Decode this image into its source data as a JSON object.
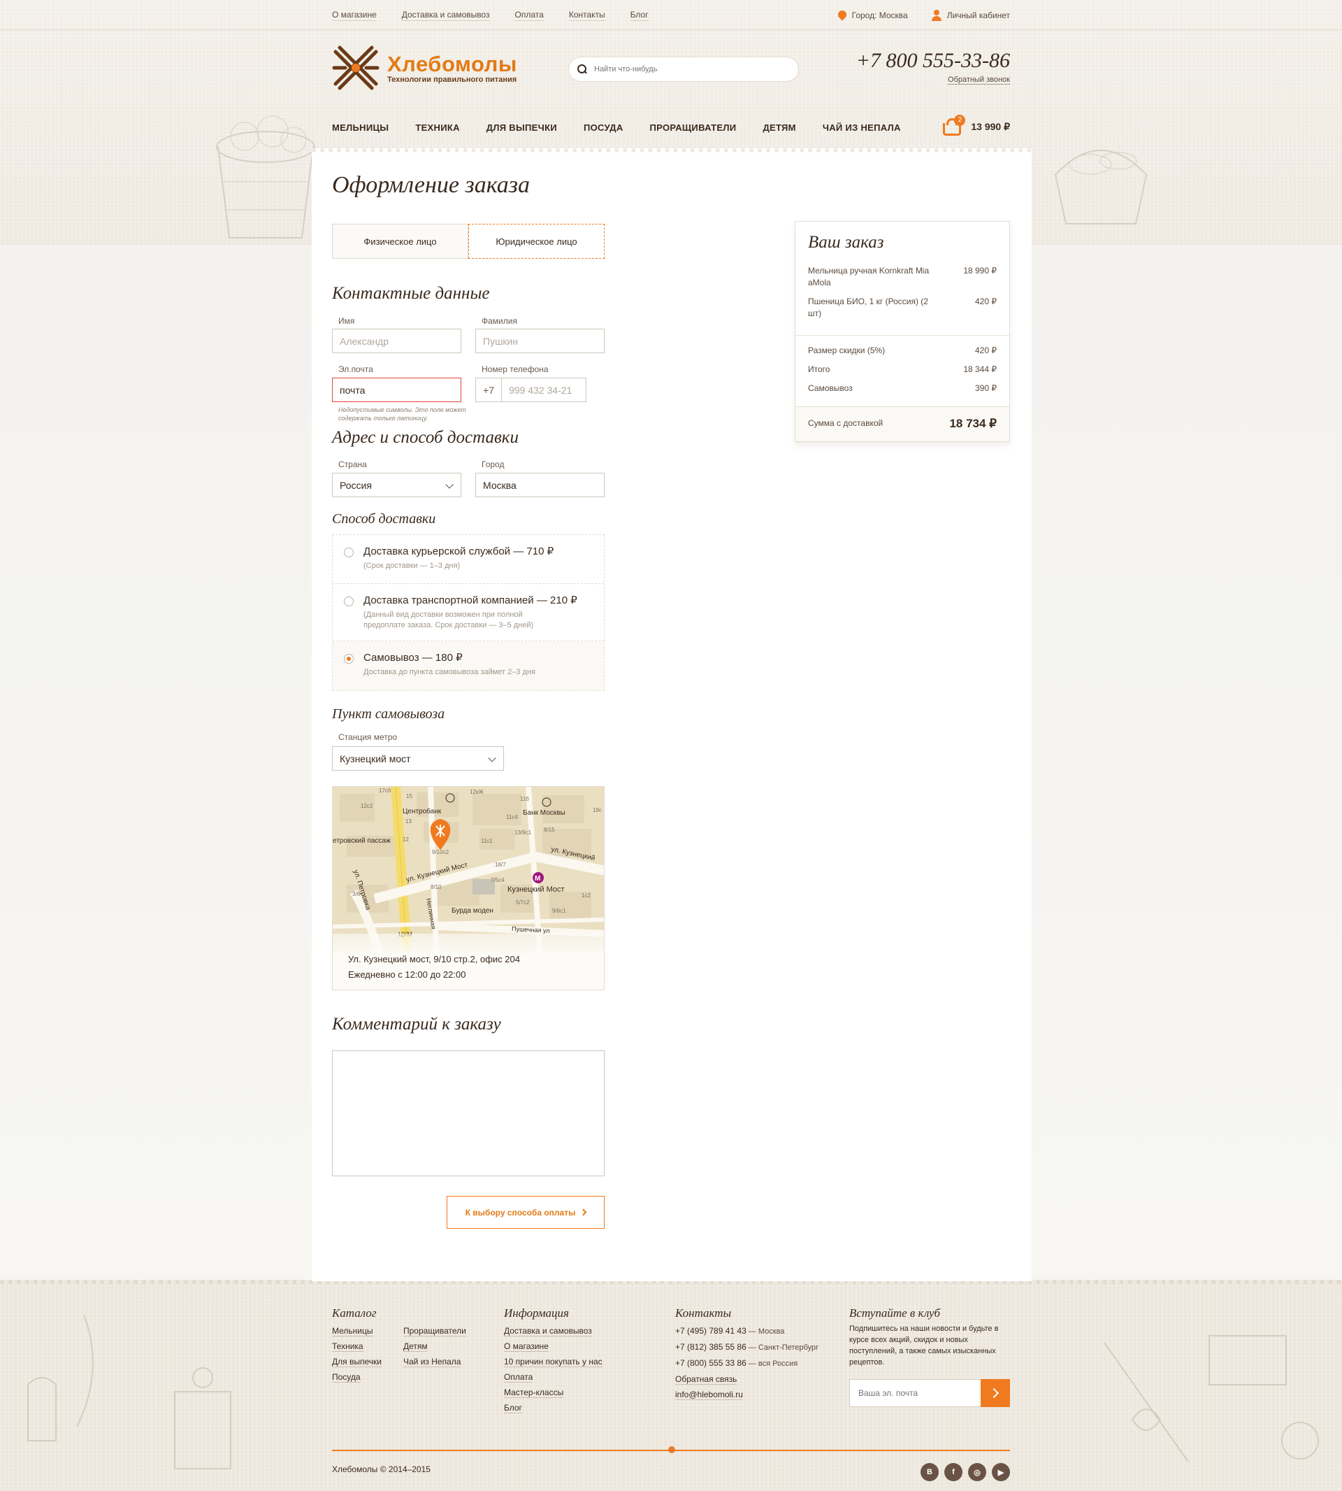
{
  "topnav": {
    "links": [
      "О магазине",
      "Доставка и самовывоз",
      "Оплата",
      "Контакты",
      "Блог"
    ],
    "city": "Город: Москва",
    "account": "Личный кабинет"
  },
  "header": {
    "logo_title": "Хлебомолы",
    "logo_subtitle": "Технологии правильного питания",
    "search_placeholder": "Найти что-нибудь",
    "phone": "+7 800 555-33-86",
    "callback": "Обратный звонок"
  },
  "mainnav": [
    "Мельницы",
    "Техника",
    "Для выпечки",
    "Посуда",
    "Проращиватели",
    "Детям",
    "Чай из Непала"
  ],
  "cart": {
    "count": "2",
    "sum": "13 990 ₽"
  },
  "page_title": "Оформление заказа",
  "tabs": [
    "Физическое лицо",
    "Юридическое лицо"
  ],
  "contacts": {
    "title": "Контактные данные",
    "name_label": "Имя",
    "name_placeholder": "Александр",
    "surname_label": "Фамилия",
    "surname_placeholder": "Пушкин",
    "email_label": "Эл.почта",
    "email_value": "почта",
    "email_error": "Недопустимые символы. Это поле может содержать только латиницу.",
    "phone_label": "Номер телефона",
    "phone_prefix": "+7",
    "phone_placeholder": "999 432 34-21"
  },
  "address": {
    "title": "Адрес и способ доставки",
    "country_label": "Страна",
    "country_value": "Россия",
    "city_label": "Город",
    "city_value": "Москва"
  },
  "delivery": {
    "title": "Способ доставки",
    "options": [
      {
        "title": "Доставка курьерской службой — 710 ₽",
        "note": "(Срок доставки — 1–3 дня)"
      },
      {
        "title": "Доставка транспортной компанией — 210 ₽",
        "note": "(Данный вид доставки возможен при полной предоплате заказа. Срок доставки — 3–5 дней)"
      },
      {
        "title": "Самовывоз — 180 ₽",
        "note": "Доставка до пункта самовывоза займет 2–3 дня"
      }
    ],
    "selected": 2
  },
  "pickup": {
    "title": "Пункт самовывоза",
    "metro_label": "Станция метро",
    "metro_value": "Кузнецкий мост",
    "map_labels": {
      "street1": "ул. Кузнецкий Мост",
      "street2": "ул. Петровка",
      "street3": "ул. Кузнецкий",
      "metro": "Кузнецкий Мост",
      "bank1": "Центробанк",
      "bank2": "Банк Москвы",
      "passage": "етровский пассаж",
      "shop": "Бурда моден",
      "street4": "Неглинная",
      "street5": "Пушечная ул",
      "tsum": "ЦУМ",
      "numbers": [
        "17с6",
        "15",
        "12с2",
        "13",
        "12",
        "12кЖ",
        "11б",
        "11с4",
        "19с",
        "9/10с2",
        "11с1",
        "13/9с1",
        "8/15",
        "18/7",
        "7/5с4",
        "8/10",
        "3/6",
        "5/7с2",
        "1с2",
        "9/6с1"
      ]
    },
    "address": "Ул. Кузнецкий мост, 9/10 стр.2, офис 204",
    "hours": "Ежедневно с 12:00 до 22:00"
  },
  "comment_title": "Комментарий к заказу",
  "next_button": "К выбору способа оплаты",
  "order": {
    "title": "Ваш заказ",
    "items": [
      {
        "name": "Мельница ручная Kornkraft Mia aMola",
        "price": "18 990 ₽"
      },
      {
        "name": "Пшеница БИО, 1 кг (Россия) (2 шт)",
        "price": "420 ₽"
      }
    ],
    "discount_label": "Размер скидки (5%)",
    "discount": "420 ₽",
    "total_label": "Итого",
    "total": "18 344 ₽",
    "pickup_label": "Самовывоз",
    "pickup": "390 ₽",
    "grand_label": "Сумма с доставкой",
    "grand": "18 734 ₽"
  },
  "footer": {
    "catalog_title": "Каталог",
    "catalog_col1": [
      "Мельницы",
      "Техника",
      "Для выпечки",
      "Посуда"
    ],
    "catalog_col2": [
      "Проращиватели",
      "Детям",
      "Чай из Непала"
    ],
    "info_title": "Информация",
    "info_links": [
      "Доставка и самовывоз",
      "О магазине",
      "10 причин покупать у нас",
      "Оплата",
      "Мастер-классы",
      "Блог"
    ],
    "contacts_title": "Контакты",
    "contacts": [
      {
        "phone": "+7 (495) 789 41 43",
        "city": " — Москва"
      },
      {
        "phone": "+7 (812) 385 55 86",
        "city": " — Санкт-Петербург"
      },
      {
        "phone": "+7 (800) 555 33 86",
        "city": " — вся Россия"
      }
    ],
    "feedback": "Обратная связь",
    "email": "info@hlebomoli.ru",
    "club_title": "Вступайте в клуб",
    "club_text": "Подпишитесь на наши новости и будьте в курсе всех акций, скидок и новых поступлений, а также самых изысканных рецептов.",
    "subscribe_placeholder": "Ваша эл. почта",
    "copyright": "Хлебомолы © 2014–2015",
    "social": [
      "B",
      "f",
      "◎",
      "▶"
    ]
  },
  "colors": {
    "accent": "#f07a20",
    "text": "#3a2a1e",
    "error": "#e2463a"
  }
}
